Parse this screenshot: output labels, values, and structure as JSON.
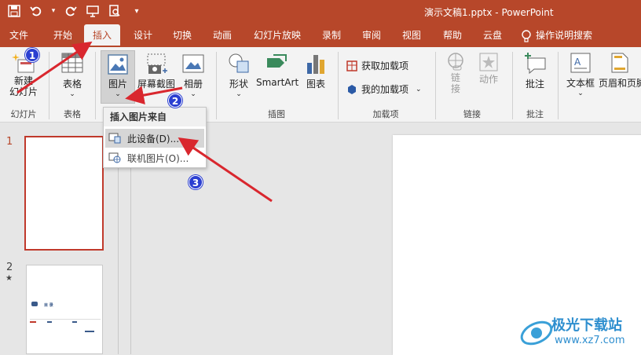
{
  "qat": {
    "save": "save-icon",
    "undo": "undo-icon",
    "redo": "redo-icon",
    "present": "present-icon",
    "preview": "preview-icon",
    "more": "▾"
  },
  "title": "演示文稿1.pptx  -  PowerPoint",
  "tabs": [
    "文件",
    "开始",
    "插入",
    "设计",
    "切换",
    "动画",
    "幻灯片放映",
    "录制",
    "审阅",
    "视图",
    "帮助",
    "云盘"
  ],
  "tell_me": "操作说明搜索",
  "ribbon": {
    "new_slide": "新建\n幻灯片",
    "new_slide_l1": "新建",
    "new_slide_l2": "幻灯片",
    "table": "表格",
    "picture": "图片",
    "screenshot": "屏幕截图",
    "album": "相册",
    "shapes": "形状",
    "smartart": "SmartArt",
    "chart": "图表",
    "get_addins": "获取加载项",
    "my_addins": "我的加载项",
    "link_l1": "链",
    "link_l2": "接",
    "action": "动作",
    "comment": "批注",
    "textbox": "文本框",
    "header_footer": "页眉和页脚",
    "groups": {
      "slides": "幻灯片",
      "tables": "表格",
      "illustrations": "插图",
      "addins": "加载项",
      "links": "链接",
      "comments": "批注"
    }
  },
  "menu": {
    "header": "插入图片来自",
    "this_device": "此设备(D)...",
    "online": "联机图片(O)..."
  },
  "slides": [
    {
      "num": "1"
    },
    {
      "num": "2",
      "mark": "★"
    }
  ],
  "thumb2": {
    "title": "目    录"
  },
  "badges": [
    "1",
    "2",
    "3"
  ],
  "watermark": {
    "cn": "极光下载站",
    "url": "www.xz7.com"
  },
  "colors": {
    "accent": "#b7472a",
    "badge": "#2b3fd1",
    "arrow": "#d9272e"
  }
}
